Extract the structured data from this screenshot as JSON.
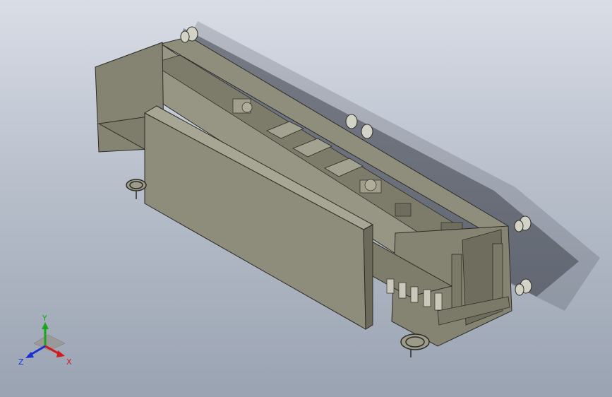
{
  "viewport": {
    "background_top": "#d9dde6",
    "background_bottom": "#9aa3b2",
    "part_color": "#8b8a78",
    "panel_color": "#8e8c7a",
    "edge_color": "#2b2b26"
  },
  "triad": {
    "x_label": "X",
    "y_label": "Y",
    "z_label": "Z",
    "x_color": "#d11a1a",
    "y_color": "#1aa51a",
    "z_color": "#1a2fd1"
  }
}
